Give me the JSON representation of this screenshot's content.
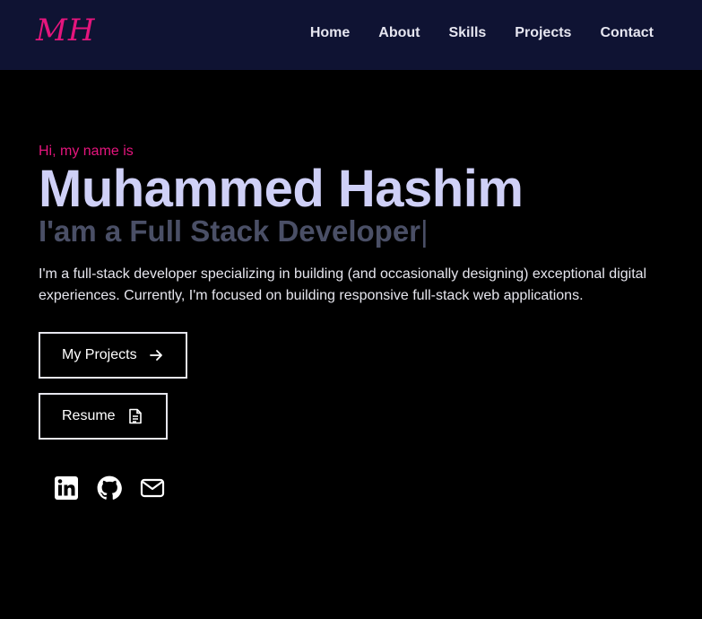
{
  "logo": "MH",
  "nav": {
    "items": [
      {
        "label": "Home"
      },
      {
        "label": "About"
      },
      {
        "label": "Skills"
      },
      {
        "label": "Projects"
      },
      {
        "label": "Contact"
      }
    ]
  },
  "hero": {
    "greeting": "Hi, my name is",
    "name": "Muhammed Hashim",
    "role": "I'am a Full Stack Developer",
    "cursor": "|",
    "intro": "I'm a full-stack developer specializing in building (and occasionally designing) exceptional digital experiences. Currently, I'm focused on building responsive full-stack web applications."
  },
  "buttons": {
    "projects_label": "My Projects",
    "resume_label": "Resume"
  },
  "socials": [
    {
      "icon": "linkedin-icon"
    },
    {
      "icon": "github-icon"
    },
    {
      "icon": "mail-icon"
    }
  ],
  "colors": {
    "accent": "#e5157d",
    "navbar_bg": "#0f1333",
    "name_color": "#cfd0f7",
    "role_color": "#4a4f66"
  }
}
